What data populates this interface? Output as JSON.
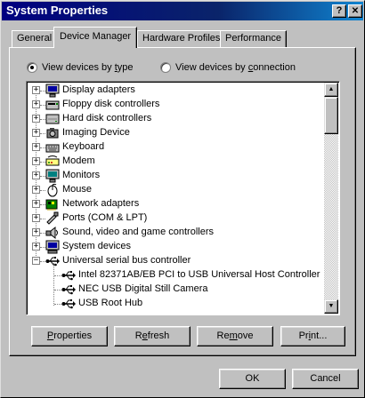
{
  "window": {
    "title": "System Properties",
    "help_glyph": "?",
    "close_glyph": "✕"
  },
  "tabs": [
    {
      "label": "General"
    },
    {
      "label": "Device Manager"
    },
    {
      "label": "Hardware Profiles"
    },
    {
      "label": "Performance"
    }
  ],
  "active_tab": "Device Manager",
  "view_options": {
    "by_type": {
      "label_pre": "View devices by ",
      "label_u": "t",
      "label_post": "ype",
      "checked": true
    },
    "by_connection": {
      "label_pre": "View devices by ",
      "label_u": "c",
      "label_post": "onnection",
      "checked": false
    }
  },
  "devices": [
    {
      "label": "Display adapters",
      "icon": "display-icon",
      "expander": "+"
    },
    {
      "label": "Floppy disk controllers",
      "icon": "floppy-controller-icon",
      "expander": "+"
    },
    {
      "label": "Hard disk controllers",
      "icon": "hard-disk-controller-icon",
      "expander": "+"
    },
    {
      "label": "Imaging Device",
      "icon": "imaging-device-icon",
      "expander": "+"
    },
    {
      "label": "Keyboard",
      "icon": "keyboard-icon",
      "expander": "+"
    },
    {
      "label": "Modem",
      "icon": "modem-icon",
      "expander": "+"
    },
    {
      "label": "Monitors",
      "icon": "monitor-icon",
      "expander": "+"
    },
    {
      "label": "Mouse",
      "icon": "mouse-icon",
      "expander": "+"
    },
    {
      "label": "Network adapters",
      "icon": "network-adapter-icon",
      "expander": "+"
    },
    {
      "label": "Ports (COM & LPT)",
      "icon": "port-icon",
      "expander": "+"
    },
    {
      "label": "Sound, video and game controllers",
      "icon": "sound-controller-icon",
      "expander": "+"
    },
    {
      "label": "System devices",
      "icon": "system-device-icon",
      "expander": "+"
    },
    {
      "label": "Universal serial bus controller",
      "icon": "usb-icon",
      "expander": "−"
    }
  ],
  "usb_children": [
    {
      "label": "Intel 82371AB/EB PCI to USB Universal Host Controller",
      "icon": "usb-icon"
    },
    {
      "label": "NEC USB Digital Still Camera",
      "icon": "usb-icon"
    },
    {
      "label": "USB Root Hub",
      "icon": "usb-icon"
    }
  ],
  "buttons": {
    "properties": {
      "pre": "",
      "u": "P",
      "post": "roperties"
    },
    "refresh": {
      "pre": "R",
      "u": "e",
      "post": "fresh"
    },
    "remove": {
      "pre": "Re",
      "u": "m",
      "post": "ove"
    },
    "print": {
      "pre": "Pr",
      "u": "i",
      "post": "nt..."
    },
    "ok": "OK",
    "cancel": "Cancel"
  },
  "colors": {
    "title_bar": "#000080",
    "face": "#c0c0c0",
    "window_bg": "#ffffff"
  }
}
